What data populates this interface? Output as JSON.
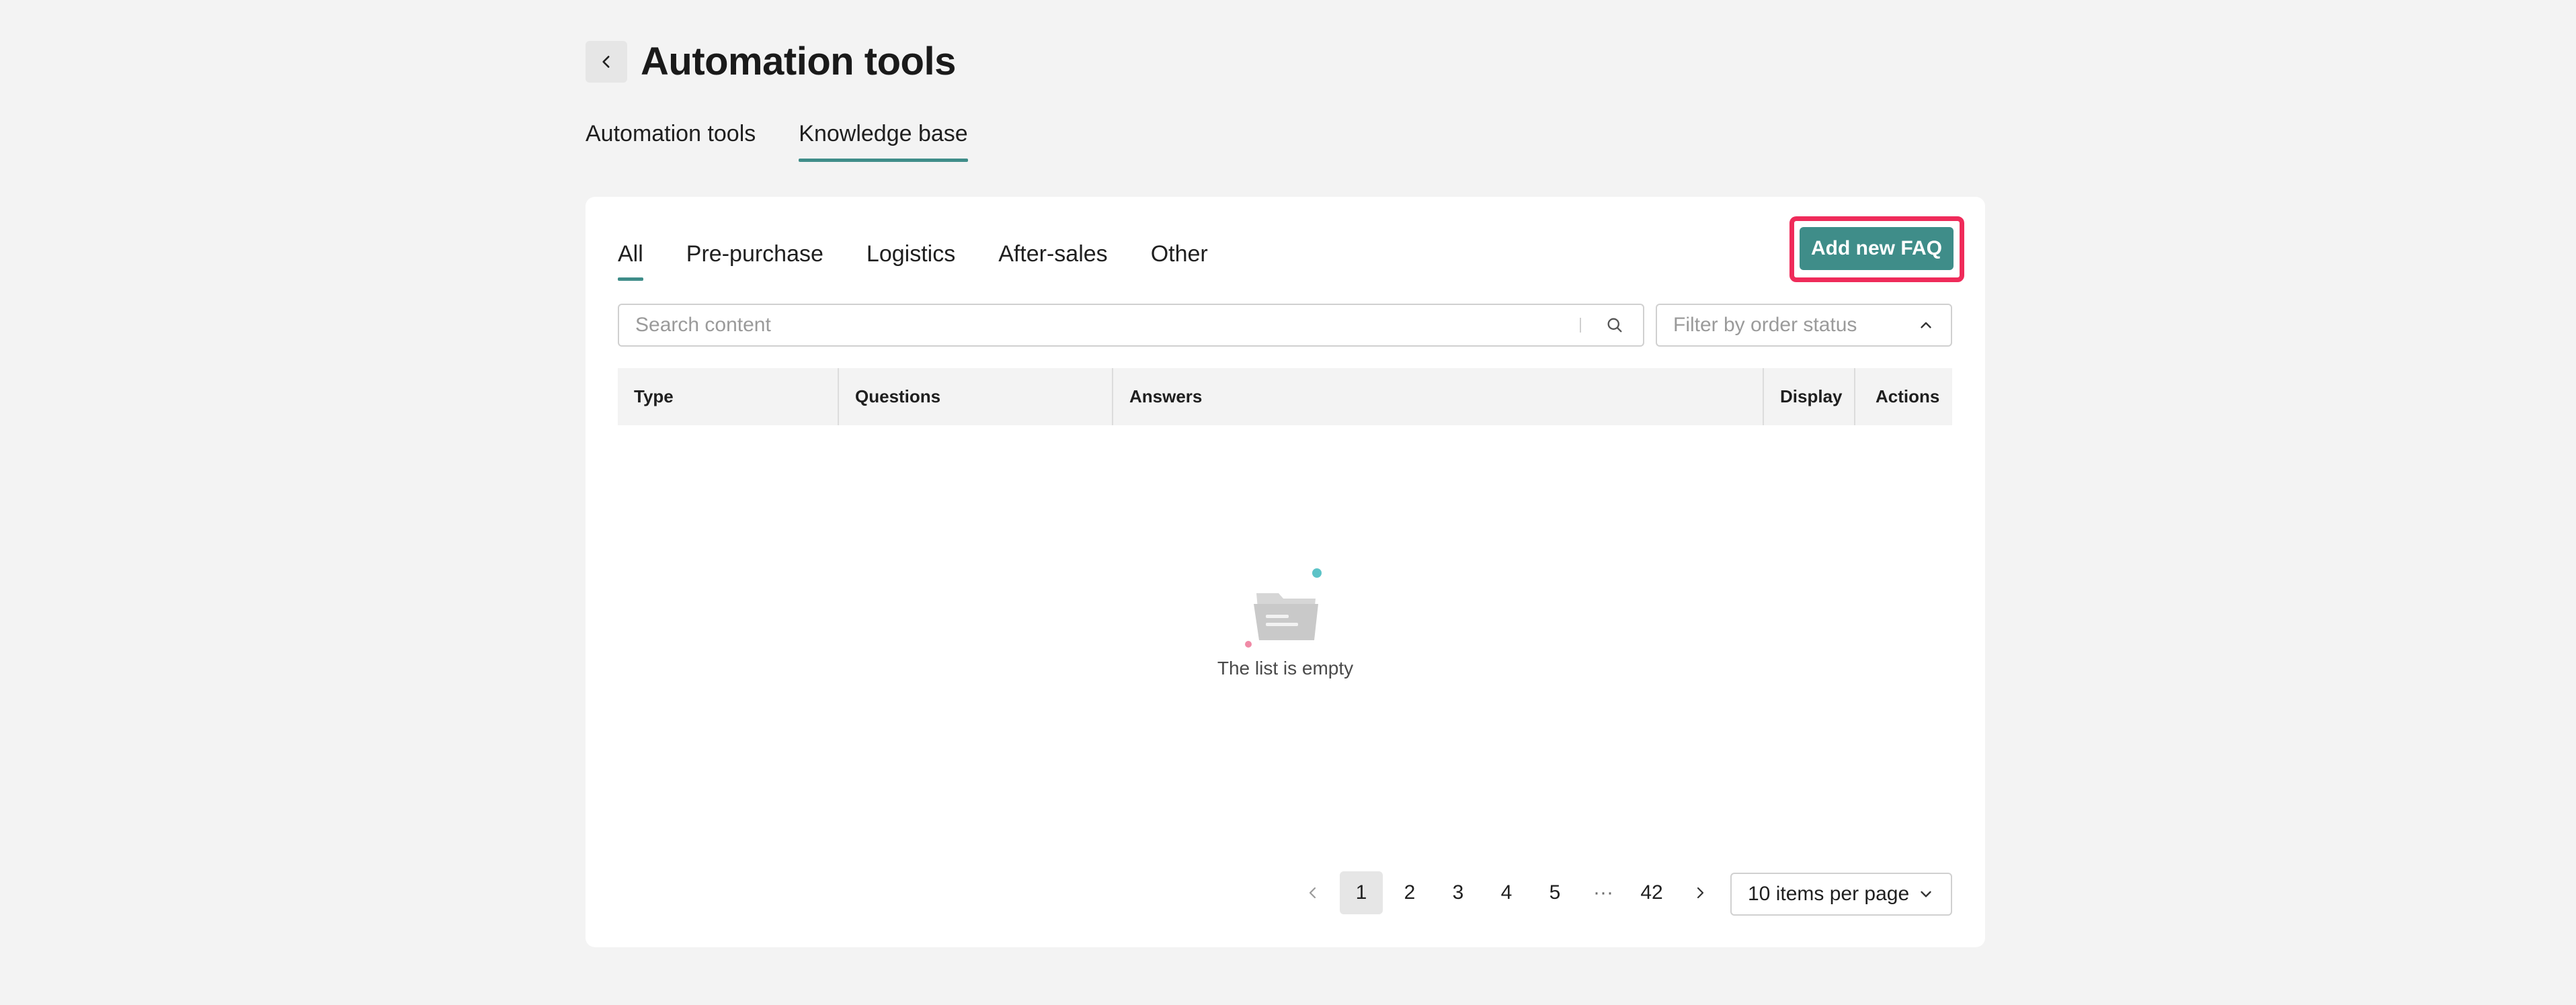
{
  "header": {
    "title": "Automation tools"
  },
  "top_tabs": [
    {
      "label": "Automation tools",
      "active": false
    },
    {
      "label": "Knowledge base",
      "active": true
    }
  ],
  "categories": [
    {
      "label": "All",
      "active": true
    },
    {
      "label": "Pre-purchase",
      "active": false
    },
    {
      "label": "Logistics",
      "active": false
    },
    {
      "label": "After-sales",
      "active": false
    },
    {
      "label": "Other",
      "active": false
    }
  ],
  "toolbar": {
    "add_label": "Add new FAQ",
    "search_placeholder": "Search content",
    "filter_placeholder": "Filter by order status"
  },
  "table": {
    "columns": [
      "Type",
      "Questions",
      "Answers",
      "Display",
      "Actions"
    ],
    "empty_text": "The list is empty"
  },
  "pagination": {
    "pages": [
      "1",
      "2",
      "3",
      "4",
      "5"
    ],
    "ellipsis": "···",
    "last_page": "42",
    "current": "1",
    "per_page_label": "10 items per page"
  },
  "colors": {
    "accent": "#3f8d89",
    "highlight": "#ef2b5a",
    "background": "#f3f3f3"
  }
}
